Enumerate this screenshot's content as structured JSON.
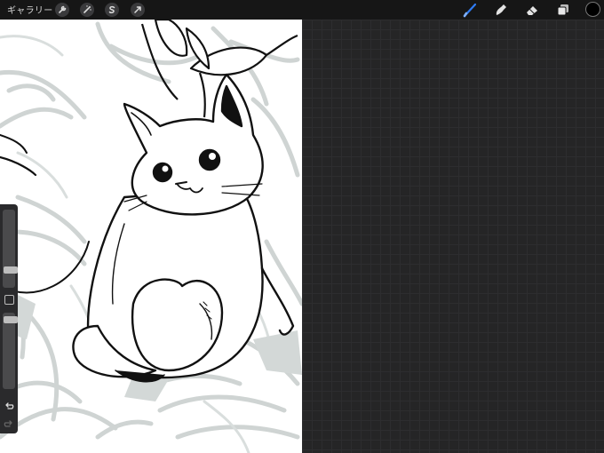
{
  "topbar": {
    "gallery_label": "ギャラリー",
    "left_icons": [
      "wrench-icon",
      "magic-wand-icon",
      "selection-s-icon",
      "transform-arrow-icon"
    ],
    "right_tools": [
      "brush-icon",
      "smudge-icon",
      "eraser-icon",
      "layers-icon"
    ],
    "active_tool": "brush",
    "accent_color": "#2f7cf6",
    "current_color": "#000000"
  },
  "sidebar": {
    "brush_size_level": 0.25,
    "opacity_level": 0.92,
    "buttons": [
      "modify-square-icon",
      "undo-icon",
      "redo-icon"
    ]
  },
  "canvas": {
    "background": "#ffffff",
    "sketch_color": "#cfd4d3",
    "ink_color": "#111111"
  },
  "workspace": {
    "background": "#252526"
  }
}
